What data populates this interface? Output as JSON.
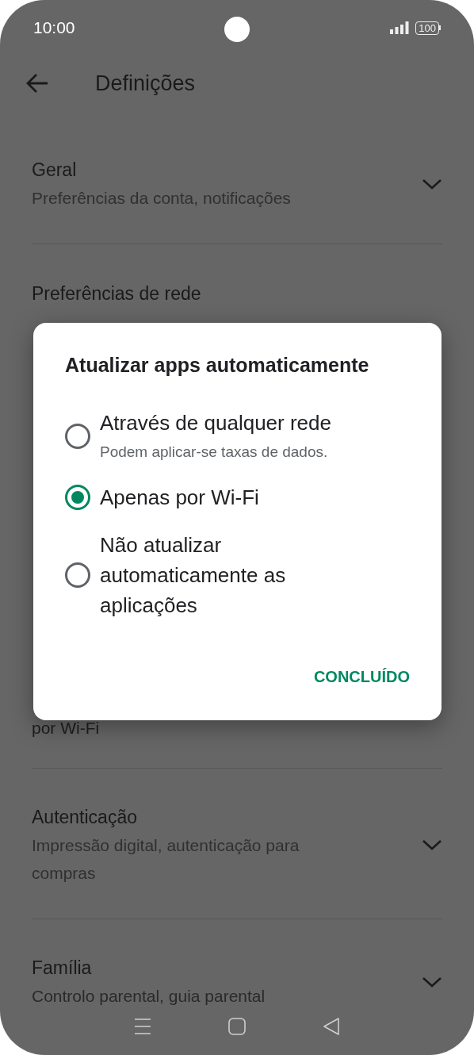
{
  "status_bar": {
    "time": "10:00",
    "battery": "100"
  },
  "app_bar": {
    "title": "Definições"
  },
  "settings": {
    "general": {
      "title": "Geral",
      "subtitle": "Preferências da conta, notificações"
    },
    "network": {
      "title": "Preferências de rede"
    },
    "hidden_item_tail": "por Wi-Fi",
    "authentication": {
      "title": "Autenticação",
      "subtitle": "Impressão digital, autenticação para compras"
    },
    "family": {
      "title": "Família",
      "subtitle": "Controlo parental, guia parental"
    }
  },
  "dialog": {
    "title": "Atualizar apps automaticamente",
    "options": [
      {
        "label": "Através de qualquer rede",
        "hint": "Podem aplicar-se taxas de dados.",
        "selected": false
      },
      {
        "label": "Apenas por Wi-Fi",
        "selected": true
      },
      {
        "label": "Não atualizar automaticamente as aplicações",
        "selected": false
      }
    ],
    "button": "CONCLUÍDO"
  }
}
